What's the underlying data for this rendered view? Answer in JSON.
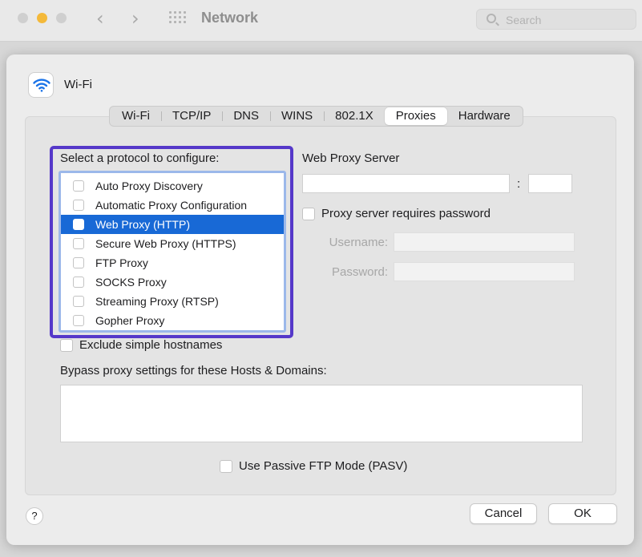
{
  "window": {
    "title": "Network",
    "search_placeholder": "Search",
    "traffic_lights": [
      "close",
      "minimize",
      "maximize"
    ],
    "minimize_color": "#f4b93a"
  },
  "sheet": {
    "interface_name": "Wi-Fi",
    "interface_icon": "wifi-icon",
    "accent_color": "#1869d6",
    "tabs": [
      {
        "label": "Wi-Fi",
        "active": false
      },
      {
        "label": "TCP/IP",
        "active": false
      },
      {
        "label": "DNS",
        "active": false
      },
      {
        "label": "WINS",
        "active": false
      },
      {
        "label": "802.1X",
        "active": false
      },
      {
        "label": "Proxies",
        "active": true
      },
      {
        "label": "Hardware",
        "active": false
      }
    ],
    "protocols": {
      "heading": "Select a protocol to configure:",
      "highlight_color": "#5538c9",
      "items": [
        {
          "label": "Auto Proxy Discovery",
          "checked": false,
          "selected": false
        },
        {
          "label": "Automatic Proxy Configuration",
          "checked": false,
          "selected": false
        },
        {
          "label": "Web Proxy (HTTP)",
          "checked": false,
          "selected": true
        },
        {
          "label": "Secure Web Proxy (HTTPS)",
          "checked": false,
          "selected": false
        },
        {
          "label": "FTP Proxy",
          "checked": false,
          "selected": false
        },
        {
          "label": "SOCKS Proxy",
          "checked": false,
          "selected": false
        },
        {
          "label": "Streaming Proxy (RTSP)",
          "checked": false,
          "selected": false
        },
        {
          "label": "Gopher Proxy",
          "checked": false,
          "selected": false
        }
      ]
    },
    "server": {
      "heading": "Web Proxy Server",
      "host_value": "",
      "separator": ":",
      "port_value": "",
      "requires_password_label": "Proxy server requires password",
      "requires_password_checked": false,
      "username_label": "Username:",
      "username_value": "",
      "password_label": "Password:",
      "password_value": ""
    },
    "exclude_label": "Exclude simple hostnames",
    "exclude_checked": false,
    "bypass_label": "Bypass proxy settings for these Hosts & Domains:",
    "bypass_value": "",
    "pasv_label": "Use Passive FTP Mode (PASV)",
    "pasv_checked": false,
    "help_label": "?",
    "cancel_label": "Cancel",
    "ok_label": "OK"
  }
}
